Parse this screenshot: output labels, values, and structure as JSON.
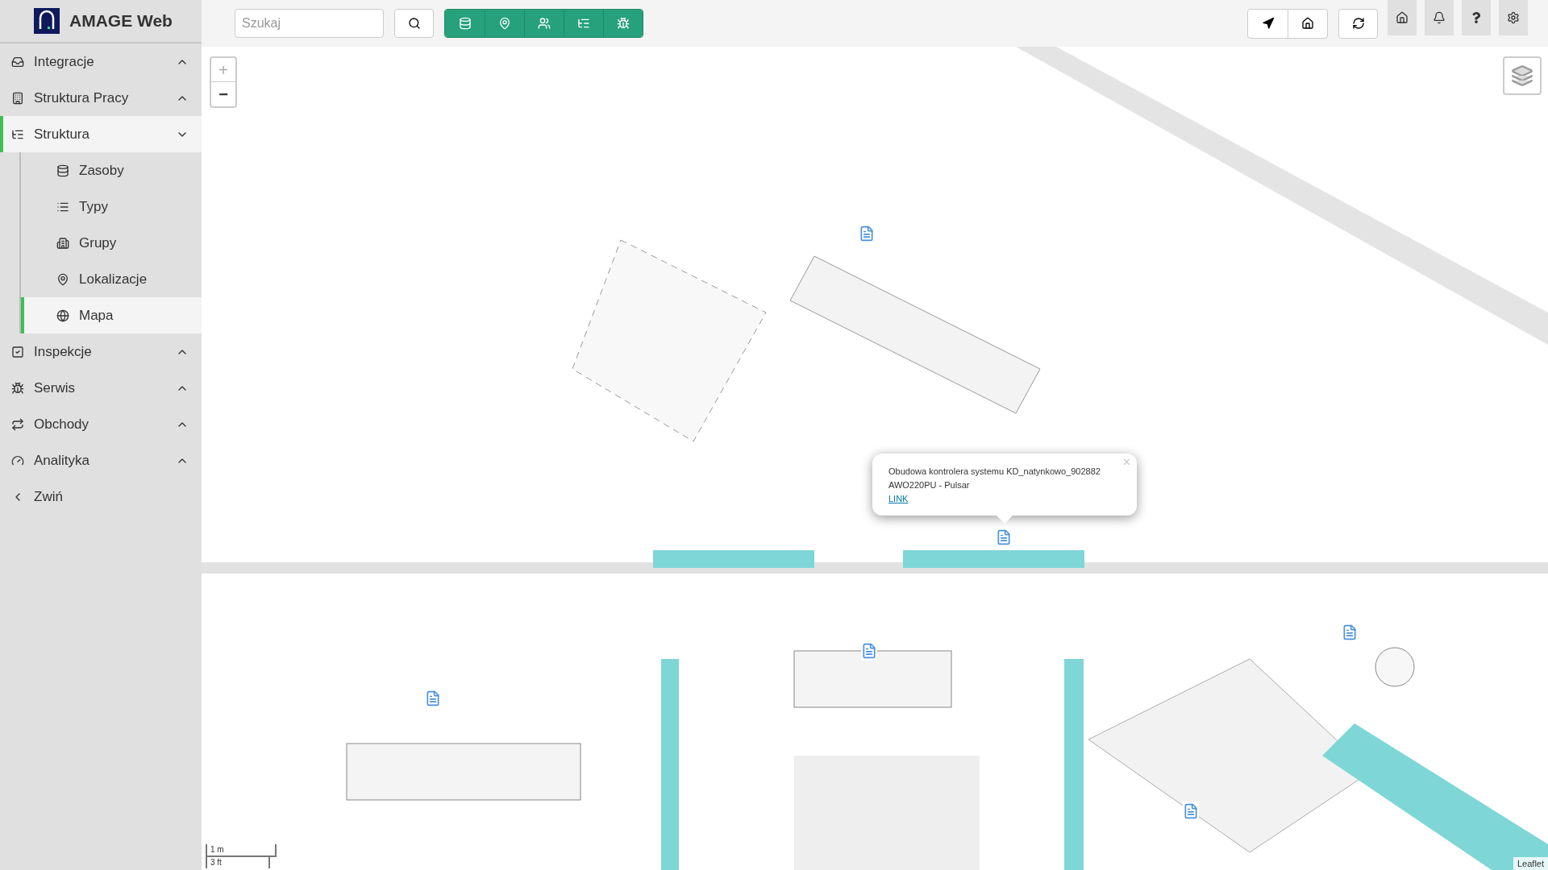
{
  "app": {
    "title": "AMAGE Web"
  },
  "search": {
    "placeholder": "Szukaj"
  },
  "sidebar": {
    "items": [
      {
        "label": "Integracje",
        "kind": "group",
        "expanded": false,
        "selected": false
      },
      {
        "label": "Struktura Pracy",
        "kind": "group",
        "expanded": false,
        "selected": false
      },
      {
        "label": "Struktura",
        "kind": "group",
        "expanded": true,
        "selected": true,
        "children": [
          {
            "label": "Zasoby",
            "selected": false
          },
          {
            "label": "Typy",
            "selected": false
          },
          {
            "label": "Grupy",
            "selected": false
          },
          {
            "label": "Lokalizacje",
            "selected": false
          },
          {
            "label": "Mapa",
            "selected": true
          }
        ]
      },
      {
        "label": "Inspekcje",
        "kind": "group",
        "expanded": false,
        "selected": false
      },
      {
        "label": "Serwis",
        "kind": "group",
        "expanded": false,
        "selected": false
      },
      {
        "label": "Obchody",
        "kind": "group",
        "expanded": false,
        "selected": false
      },
      {
        "label": "Analityka",
        "kind": "group",
        "expanded": false,
        "selected": false
      },
      {
        "label": "Zwiń",
        "kind": "action",
        "selected": false
      }
    ]
  },
  "map": {
    "zoom_in": "+",
    "zoom_out": "−",
    "popup": {
      "lines": [
        "Obudowa kontrolera systemu KD_natynkowo_902882",
        "AWO220PU - Pulsar"
      ],
      "link": "LINK",
      "close": "×"
    },
    "scale": {
      "metric": "1 m",
      "imperial": "3 ft"
    },
    "attribution": "Leaflet"
  }
}
